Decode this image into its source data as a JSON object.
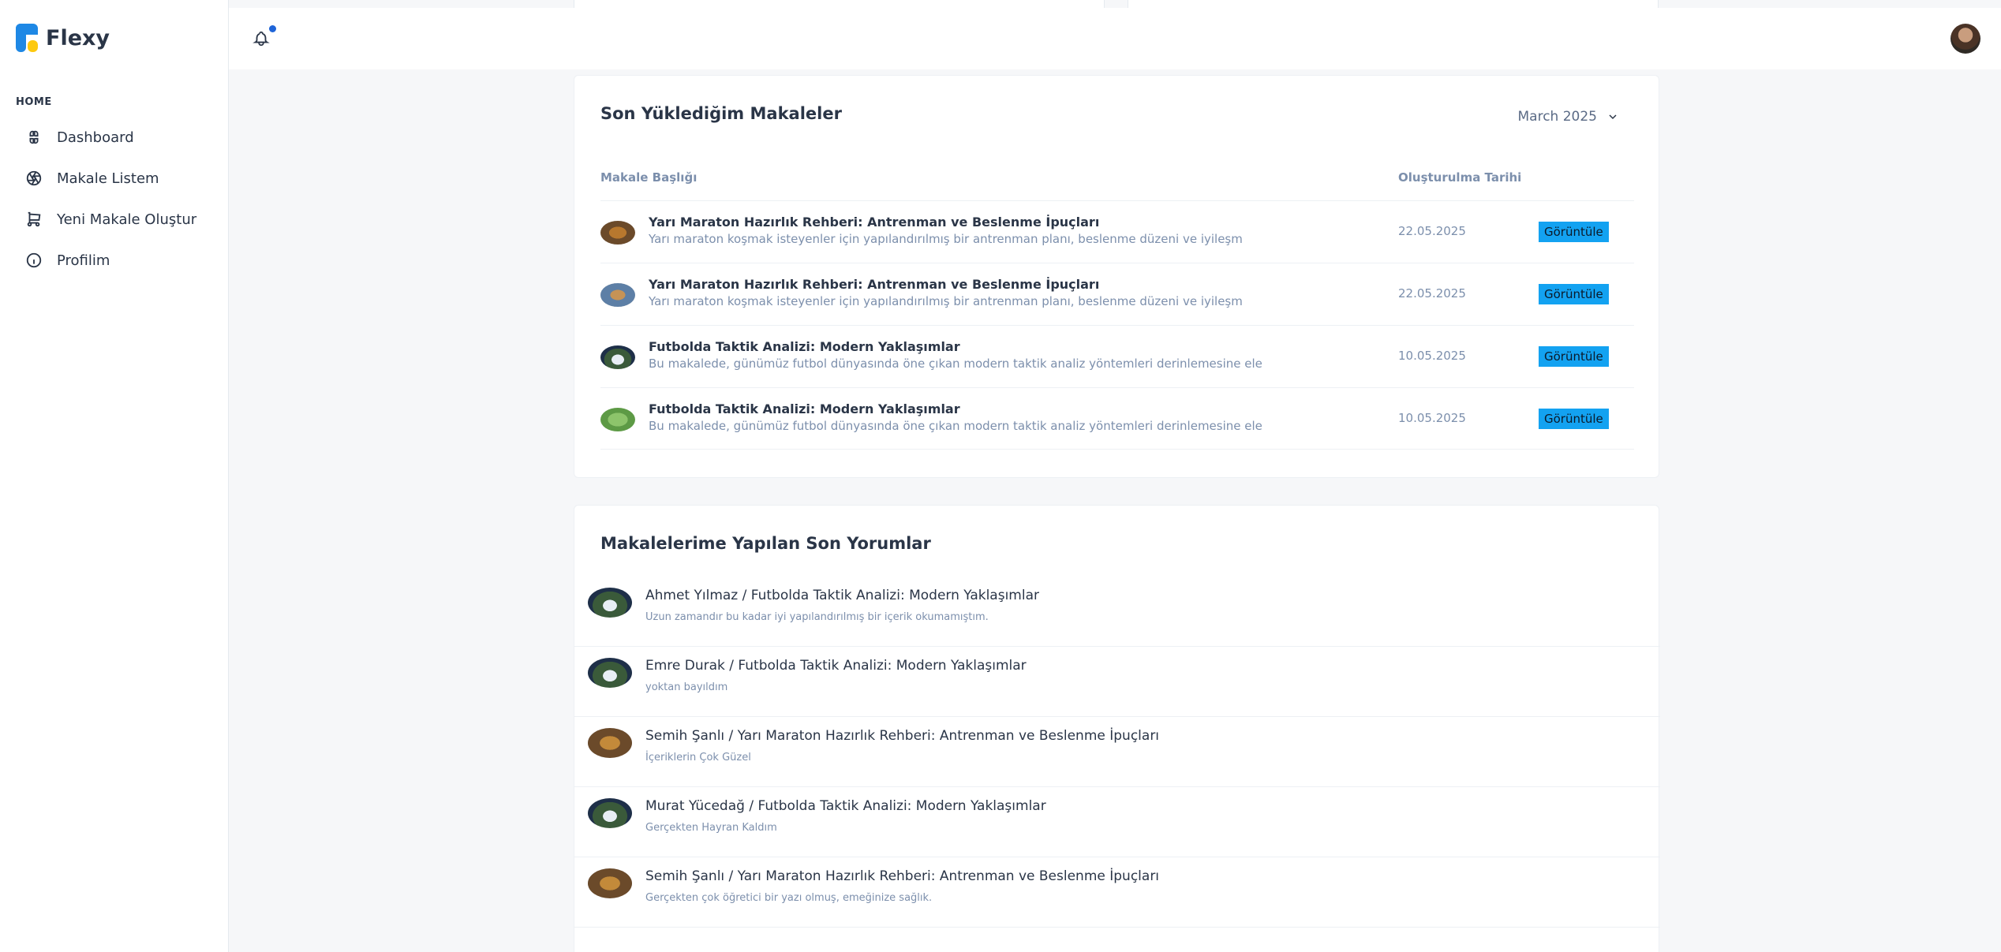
{
  "app": {
    "name": "Flexy"
  },
  "sidebar": {
    "section": "HOME",
    "items": [
      {
        "label": "Dashboard",
        "icon": "dashboard-icon"
      },
      {
        "label": "Makale Listem",
        "icon": "aperture-icon"
      },
      {
        "label": "Yeni Makale Oluştur",
        "icon": "cart-icon"
      },
      {
        "label": "Profilim",
        "icon": "info-icon"
      }
    ]
  },
  "header": {
    "notification_icon": "bell-icon",
    "avatar": "user-avatar"
  },
  "articles": {
    "title": "Son Yüklediğim Makaleler",
    "month": "March 2025",
    "columns": {
      "title": "Makale Başlığı",
      "date": "Oluşturulma Tarihi"
    },
    "rows": [
      {
        "title": "Yarı Maraton Hazırlık Rehberi: Antrenman ve Beslenme İpuçları",
        "desc": "Yarı maraton koşmak isteyenler için yapılandırılmış bir antrenman planı, beslenme düzeni ve iyileşm",
        "date": "22.05.2025",
        "button": "Görüntüle"
      },
      {
        "title": "Yarı Maraton Hazırlık Rehberi: Antrenman ve Beslenme İpuçları",
        "desc": "Yarı maraton koşmak isteyenler için yapılandırılmış bir antrenman planı, beslenme düzeni ve iyileşm",
        "date": "22.05.2025",
        "button": "Görüntüle"
      },
      {
        "title": "Futbolda Taktik Analizi: Modern Yaklaşımlar",
        "desc": "Bu makalede, günümüz futbol dünyasında öne çıkan modern taktik analiz yöntemleri derinlemesine ele",
        "date": "10.05.2025",
        "button": "Görüntüle"
      },
      {
        "title": "Futbolda Taktik Analizi: Modern Yaklaşımlar",
        "desc": "Bu makalede, günümüz futbol dünyasında öne çıkan modern taktik analiz yöntemleri derinlemesine ele",
        "date": "10.05.2025",
        "button": "Görüntüle"
      }
    ]
  },
  "comments": {
    "title": "Makalelerime Yapılan Son Yorumlar",
    "items": [
      {
        "title": "Ahmet Yılmaz / Futbolda Taktik Analizi: Modern Yaklaşımlar",
        "text": "Uzun zamandır bu kadar iyi yapılandırılmış bir içerik okumamıştım."
      },
      {
        "title": "Emre Durak / Futbolda Taktik Analizi: Modern Yaklaşımlar",
        "text": "yoktan bayıldım"
      },
      {
        "title": "Semih Şanlı / Yarı Maraton Hazırlık Rehberi: Antrenman ve Beslenme İpuçları",
        "text": "İçeriklerin Çok Güzel"
      },
      {
        "title": "Murat Yücedağ / Futbolda Taktik Analizi: Modern Yaklaşımlar",
        "text": "Gerçekten Hayran Kaldım"
      },
      {
        "title": "Semih Şanlı / Yarı Maraton Hazırlık Rehberi: Antrenman ve Beslenme İpuçları",
        "text": "Gerçekten çok öğretici bir yazı olmuş, emeğinize sağlık."
      }
    ]
  },
  "colors": {
    "accent": "#13a2f1",
    "brand": "#1e88e5",
    "text": "#2a3547",
    "muted": "#7c8fac"
  }
}
